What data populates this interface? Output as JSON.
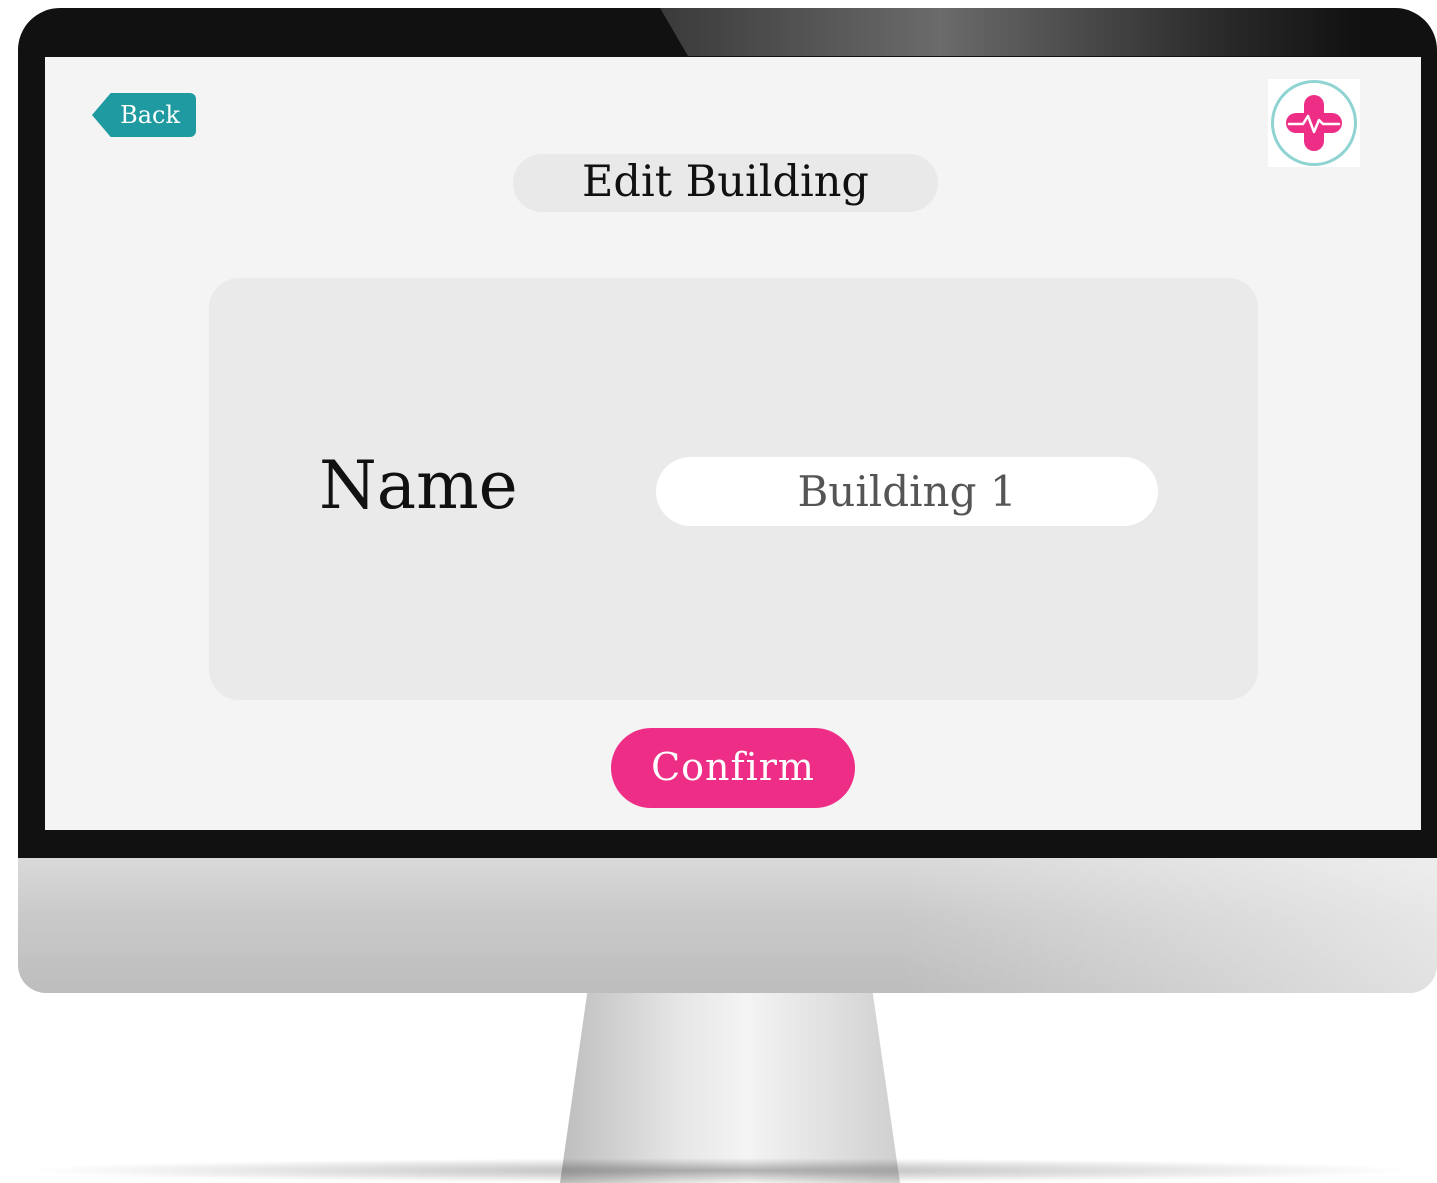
{
  "header": {
    "back_label": "Back",
    "title": "Edit Building"
  },
  "form": {
    "name_label": "Name",
    "name_value": "Building 1"
  },
  "actions": {
    "confirm_label": "Confirm"
  },
  "logo": {
    "icon": "medical-cross-heartbeat-icon"
  },
  "colors": {
    "back_button": "#1f9aa0",
    "confirm_button": "#ee2e86",
    "logo_pink": "#ee2e86",
    "logo_ring": "#8fd3d3"
  }
}
